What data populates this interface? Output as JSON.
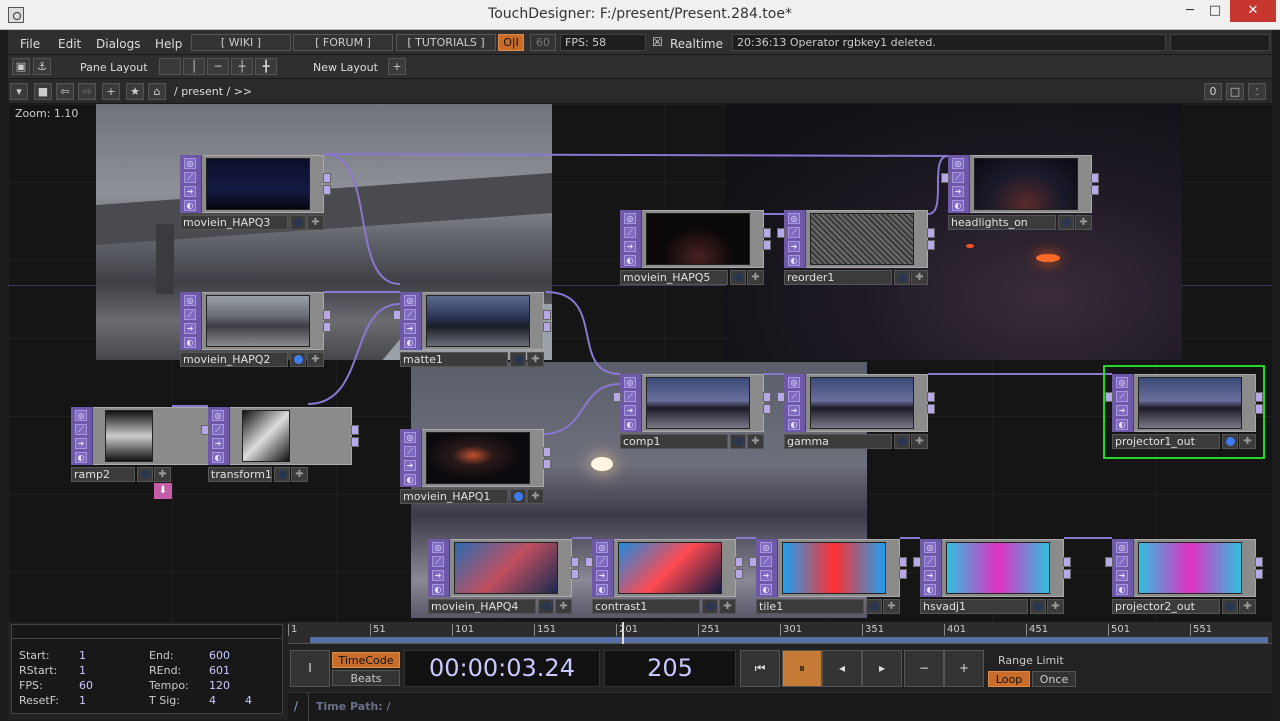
{
  "window": {
    "title": "TouchDesigner: F:/present/Present.284.toe*",
    "min": "─",
    "max": "□",
    "close": "✕"
  },
  "menu": [
    "File",
    "Edit",
    "Dialogs",
    "Help"
  ],
  "toolbar": {
    "wiki": "[ WIKI ]",
    "forum": "[ FORUM ]",
    "tutorials": "[ TUTORIALS ]",
    "oi": "O|I",
    "sixty": "60",
    "fps": "FPS:   58",
    "realtime_check": "☒",
    "realtime": "Realtime",
    "status": "20:36:13 Operator rgbkey1 deleted."
  },
  "panebar": {
    "pane_layout": "Pane Layout",
    "new_layout": "New Layout",
    "plus": "+"
  },
  "pathbar": {
    "path": "/ present / >>",
    "zero": "0"
  },
  "network": {
    "zoom": "Zoom: 1.10",
    "nodes": {
      "n1": {
        "label": "moviein_HAPQ3"
      },
      "n2": {
        "label": "moviein_HAPQ2"
      },
      "n3": {
        "label": "matte1"
      },
      "n4": {
        "label": "moviein_HAPQ5"
      },
      "n5": {
        "label": "reorder1"
      },
      "n6": {
        "label": "headlights_on"
      },
      "n7": {
        "label": "ramp2"
      },
      "n8": {
        "label": "transform1"
      },
      "n9": {
        "label": "moviein_HAPQ1"
      },
      "n10": {
        "label": "comp1"
      },
      "n11": {
        "label": "gamma"
      },
      "n12": {
        "label": "projector1_out"
      },
      "n13": {
        "label": "moviein_HAPQ4"
      },
      "n14": {
        "label": "contrast1"
      },
      "n15": {
        "label": "tile1"
      },
      "n16": {
        "label": "hsvadj1"
      },
      "n17": {
        "label": "projector2_out"
      }
    }
  },
  "timeline": {
    "start_label": "Start:",
    "start": "1",
    "end_label": "End:",
    "end": "600",
    "rstart_label": "RStart:",
    "rstart": "1",
    "rend_label": "REnd:",
    "rend": "601",
    "fps_label": "FPS:",
    "fps": "60",
    "tempo_label": "Tempo:",
    "tempo": "120",
    "resetf_label": "ResetF:",
    "resetf": "1",
    "tsig_label": "T Sig:",
    "tsig_a": "4",
    "tsig_b": "4",
    "ticks": [
      "1",
      "51",
      "101",
      "151",
      "201",
      "251",
      "301",
      "351",
      "401",
      "451",
      "501",
      "551"
    ],
    "i_btn": "I",
    "timecode": "TimeCode",
    "beats": "Beats",
    "time": "00:00:03.24",
    "frame": "205",
    "range_limit": "Range Limit",
    "loop": "Loop",
    "once": "Once",
    "time_path": "Time Path: /",
    "slash": "/"
  },
  "colors": {
    "accent": "#c96d2b",
    "node_side": "#6e58a8",
    "wire": "#8a78d0",
    "selected": "#27d427"
  }
}
